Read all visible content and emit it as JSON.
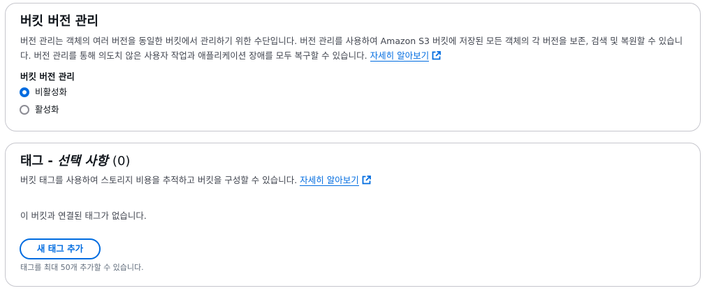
{
  "versioning": {
    "title": "버킷 버전 관리",
    "description": "버전 관리는 객체의 여러 버전을 동일한 버킷에서 관리하기 위한 수단입니다. 버전 관리를 사용하여 Amazon S3 버킷에 저장된 모든 객체의 각 버전을 보존, 검색 및 복원할 수 있습니다. 버전 관리를 통해 의도치 않은 사용자 작업과 애플리케이션 장애를 모두 복구할 수 있습니다.",
    "learn_more": "자세히 알아보기",
    "field_label": "버킷 버전 관리",
    "options": [
      {
        "label": "비활성화",
        "selected": true
      },
      {
        "label": "활성화",
        "selected": false
      }
    ]
  },
  "tags": {
    "title_prefix": "태그 - ",
    "title_optional": "선택 사항",
    "count": "(0)",
    "description": "버킷 태그를 사용하여 스토리지 비용을 추적하고 버킷을 구성할 수 있습니다.",
    "learn_more": "자세히 알아보기",
    "empty_text": "이 버킷과 연결된 태그가 없습니다.",
    "add_button": "새 태그 추가",
    "limit_hint": "태그를 최대 50개 추가할 수 있습니다."
  },
  "colors": {
    "link": "#006ce0",
    "border": "#c6c6cd",
    "text": "#0f141a",
    "secondary_text": "#424650"
  }
}
